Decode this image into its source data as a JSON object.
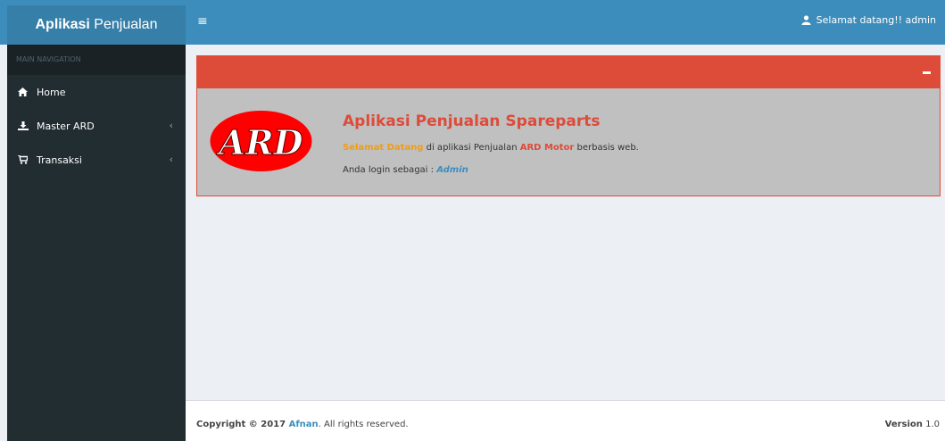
{
  "header": {
    "logo_bold": "Aplikasi",
    "logo_rest": " Penjualan",
    "toggle_icon": "≡",
    "user_text": "Selamat datang!! admin"
  },
  "sidebar": {
    "header": "MAIN NAVIGATION",
    "items": [
      {
        "label": "Home",
        "icon": "home-icon"
      },
      {
        "label": "Master ARD",
        "icon": "download-icon",
        "chevron": "‹"
      },
      {
        "label": "Transaksi",
        "icon": "cart-icon",
        "chevron": "‹"
      }
    ]
  },
  "box": {
    "collapse_icon": "minus-icon",
    "logo_text": "ARD",
    "title": "Aplikasi Penjualan Spareparts",
    "line1": {
      "highlight1": "Selamat Datang",
      "text1": " di aplikasi Penjualan ",
      "highlight2": "ARD Motor",
      "text2": " berbasis web."
    },
    "line2": {
      "text": "Anda login sebagai : ",
      "role": "Admin"
    }
  },
  "footer": {
    "copyright": "Copyright © 2017 ",
    "author": "Afnan",
    "rights": ". All rights reserved.",
    "version_label": "Version",
    "version_number": " 1.0"
  },
  "colors": {
    "topbar": "#3c8dbc",
    "logo_bg": "#367fa9",
    "sidebar": "#222d32",
    "accent_red": "#dd4b39",
    "accent_orange": "#f39c12",
    "content_bg": "#ecf0f5"
  }
}
